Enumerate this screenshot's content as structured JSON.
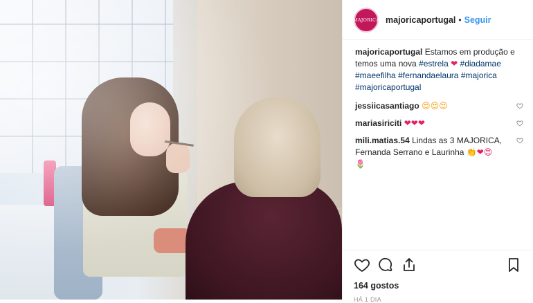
{
  "post": {
    "image_alt": "",
    "account": {
      "username": "majoricaportugal",
      "avatar_text": "MAJORICA",
      "separator": "•",
      "follow_label": "Seguir"
    },
    "caption": {
      "user": "majoricaportugal",
      "text": "Estamos em produção e temos uma nova",
      "tag1": "#estrela",
      "emoji": "❤",
      "tag2": "#diadamae",
      "tag3": "#maeefilha",
      "tag4": "#fernandaelaura",
      "tag5": "#majorica",
      "tag6": "#majoricaportugal"
    },
    "comments": [
      {
        "user": "jessiicasantiago",
        "text": "",
        "emoji": "😍😍😍"
      },
      {
        "user": "mariasiriciti",
        "text": "",
        "emoji": "❤❤❤"
      },
      {
        "user": "mili.matias.54",
        "text": "Lindas as 3 MAJORICA, Fernanda Serrano e Laurinha",
        "emoji": "👏❤😍",
        "emoji2": "🌷"
      }
    ],
    "likes": "164 gostos",
    "time": "HÁ 1 DIA"
  },
  "icons": {
    "like": "heart-icon",
    "comment": "comment-icon",
    "share": "share-icon",
    "save": "bookmark-icon",
    "comment_like": "heart-small-icon"
  },
  "colors": {
    "link": "#3897f0",
    "hashtag": "#003569",
    "brand": "#c2185b"
  }
}
